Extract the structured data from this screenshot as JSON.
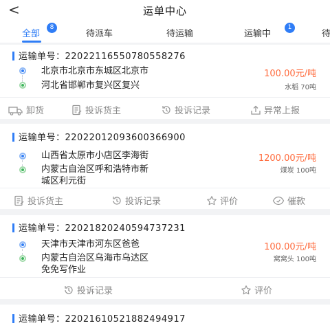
{
  "header": {
    "back_icon": "chevron-left-icon",
    "back_glyph": "<",
    "title": "运单中心"
  },
  "tabs": [
    {
      "label": "全部",
      "badge": "8",
      "active": true
    },
    {
      "label": "待派车"
    },
    {
      "label": "待运输"
    },
    {
      "label": "运输中",
      "badge": "1"
    },
    {
      "label": "待"
    }
  ],
  "accent_color": "#2f7df6",
  "price_color": "#ff6b3d",
  "orders": [
    {
      "waybill_label": "运输单号：",
      "waybill_no": "2202211655078055827​6",
      "from": "北京市北京市东城区北京市",
      "to": "河北省邯郸市复兴区复兴",
      "price": "100.00元/吨",
      "cargo": "水稻 70吨",
      "actions": [
        {
          "label": "卸货",
          "icon": "truck-icon"
        },
        {
          "label": "投诉货主",
          "icon": "complaint-icon"
        },
        {
          "label": "投诉记录",
          "icon": "history-icon"
        },
        {
          "label": "异常上报",
          "icon": "upload-icon"
        }
      ]
    },
    {
      "waybill_label": "运输单号：",
      "waybill_no": "2202201209360036690​0",
      "from": "山西省太原市小店区李海街",
      "to_line1": "内蒙古自治区呼和浩特市新",
      "to_line2": "城区利元街",
      "price": "1200.00元/吨",
      "cargo": "煤炭 100吨",
      "actions": [
        {
          "label": "投诉货主",
          "icon": "complaint-icon"
        },
        {
          "label": "投诉记录",
          "icon": "history-icon"
        },
        {
          "label": "评价",
          "icon": "rating-icon"
        },
        {
          "label": "催款",
          "icon": "payment-reminder-icon"
        }
      ]
    },
    {
      "waybill_label": "运输单号：",
      "waybill_no": "2202182024059473723​1",
      "from": "天津市天津市河东区爸爸",
      "to_line1": "内蒙古自治区乌海市乌达区",
      "to_line2": "免免写作业",
      "price": "100.00元/吨",
      "cargo": "窝窝头 100吨",
      "actions": [
        {
          "label": "投诉记录",
          "icon": "history-icon"
        },
        {
          "label": "评价",
          "icon": "rating-icon"
        }
      ]
    },
    {
      "waybill_label": "运输单号：",
      "waybill_no": "2202161052188249491​7"
    }
  ]
}
